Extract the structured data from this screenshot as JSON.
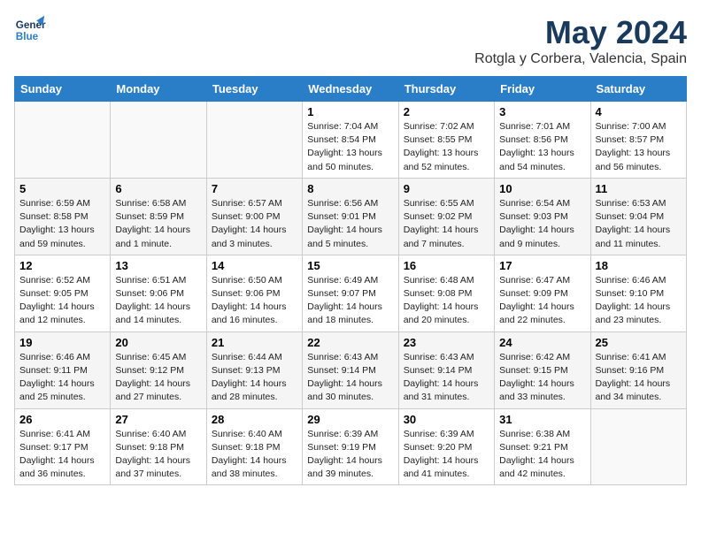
{
  "header": {
    "logo_line1": "General",
    "logo_line2": "Blue",
    "month": "May 2024",
    "location": "Rotgla y Corbera, Valencia, Spain"
  },
  "days_of_week": [
    "Sunday",
    "Monday",
    "Tuesday",
    "Wednesday",
    "Thursday",
    "Friday",
    "Saturday"
  ],
  "weeks": [
    [
      {
        "day": "",
        "info": ""
      },
      {
        "day": "",
        "info": ""
      },
      {
        "day": "",
        "info": ""
      },
      {
        "day": "1",
        "info": "Sunrise: 7:04 AM\nSunset: 8:54 PM\nDaylight: 13 hours\nand 50 minutes."
      },
      {
        "day": "2",
        "info": "Sunrise: 7:02 AM\nSunset: 8:55 PM\nDaylight: 13 hours\nand 52 minutes."
      },
      {
        "day": "3",
        "info": "Sunrise: 7:01 AM\nSunset: 8:56 PM\nDaylight: 13 hours\nand 54 minutes."
      },
      {
        "day": "4",
        "info": "Sunrise: 7:00 AM\nSunset: 8:57 PM\nDaylight: 13 hours\nand 56 minutes."
      }
    ],
    [
      {
        "day": "5",
        "info": "Sunrise: 6:59 AM\nSunset: 8:58 PM\nDaylight: 13 hours\nand 59 minutes."
      },
      {
        "day": "6",
        "info": "Sunrise: 6:58 AM\nSunset: 8:59 PM\nDaylight: 14 hours\nand 1 minute."
      },
      {
        "day": "7",
        "info": "Sunrise: 6:57 AM\nSunset: 9:00 PM\nDaylight: 14 hours\nand 3 minutes."
      },
      {
        "day": "8",
        "info": "Sunrise: 6:56 AM\nSunset: 9:01 PM\nDaylight: 14 hours\nand 5 minutes."
      },
      {
        "day": "9",
        "info": "Sunrise: 6:55 AM\nSunset: 9:02 PM\nDaylight: 14 hours\nand 7 minutes."
      },
      {
        "day": "10",
        "info": "Sunrise: 6:54 AM\nSunset: 9:03 PM\nDaylight: 14 hours\nand 9 minutes."
      },
      {
        "day": "11",
        "info": "Sunrise: 6:53 AM\nSunset: 9:04 PM\nDaylight: 14 hours\nand 11 minutes."
      }
    ],
    [
      {
        "day": "12",
        "info": "Sunrise: 6:52 AM\nSunset: 9:05 PM\nDaylight: 14 hours\nand 12 minutes."
      },
      {
        "day": "13",
        "info": "Sunrise: 6:51 AM\nSunset: 9:06 PM\nDaylight: 14 hours\nand 14 minutes."
      },
      {
        "day": "14",
        "info": "Sunrise: 6:50 AM\nSunset: 9:06 PM\nDaylight: 14 hours\nand 16 minutes."
      },
      {
        "day": "15",
        "info": "Sunrise: 6:49 AM\nSunset: 9:07 PM\nDaylight: 14 hours\nand 18 minutes."
      },
      {
        "day": "16",
        "info": "Sunrise: 6:48 AM\nSunset: 9:08 PM\nDaylight: 14 hours\nand 20 minutes."
      },
      {
        "day": "17",
        "info": "Sunrise: 6:47 AM\nSunset: 9:09 PM\nDaylight: 14 hours\nand 22 minutes."
      },
      {
        "day": "18",
        "info": "Sunrise: 6:46 AM\nSunset: 9:10 PM\nDaylight: 14 hours\nand 23 minutes."
      }
    ],
    [
      {
        "day": "19",
        "info": "Sunrise: 6:46 AM\nSunset: 9:11 PM\nDaylight: 14 hours\nand 25 minutes."
      },
      {
        "day": "20",
        "info": "Sunrise: 6:45 AM\nSunset: 9:12 PM\nDaylight: 14 hours\nand 27 minutes."
      },
      {
        "day": "21",
        "info": "Sunrise: 6:44 AM\nSunset: 9:13 PM\nDaylight: 14 hours\nand 28 minutes."
      },
      {
        "day": "22",
        "info": "Sunrise: 6:43 AM\nSunset: 9:14 PM\nDaylight: 14 hours\nand 30 minutes."
      },
      {
        "day": "23",
        "info": "Sunrise: 6:43 AM\nSunset: 9:14 PM\nDaylight: 14 hours\nand 31 minutes."
      },
      {
        "day": "24",
        "info": "Sunrise: 6:42 AM\nSunset: 9:15 PM\nDaylight: 14 hours\nand 33 minutes."
      },
      {
        "day": "25",
        "info": "Sunrise: 6:41 AM\nSunset: 9:16 PM\nDaylight: 14 hours\nand 34 minutes."
      }
    ],
    [
      {
        "day": "26",
        "info": "Sunrise: 6:41 AM\nSunset: 9:17 PM\nDaylight: 14 hours\nand 36 minutes."
      },
      {
        "day": "27",
        "info": "Sunrise: 6:40 AM\nSunset: 9:18 PM\nDaylight: 14 hours\nand 37 minutes."
      },
      {
        "day": "28",
        "info": "Sunrise: 6:40 AM\nSunset: 9:18 PM\nDaylight: 14 hours\nand 38 minutes."
      },
      {
        "day": "29",
        "info": "Sunrise: 6:39 AM\nSunset: 9:19 PM\nDaylight: 14 hours\nand 39 minutes."
      },
      {
        "day": "30",
        "info": "Sunrise: 6:39 AM\nSunset: 9:20 PM\nDaylight: 14 hours\nand 41 minutes."
      },
      {
        "day": "31",
        "info": "Sunrise: 6:38 AM\nSunset: 9:21 PM\nDaylight: 14 hours\nand 42 minutes."
      },
      {
        "day": "",
        "info": ""
      }
    ]
  ]
}
